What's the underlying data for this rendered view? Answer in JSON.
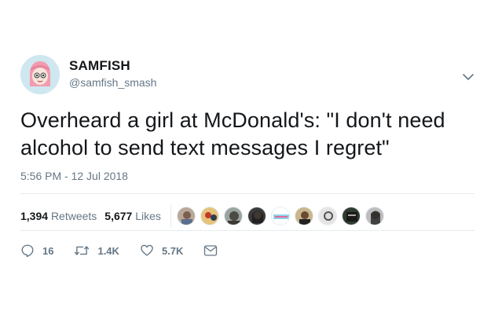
{
  "author": {
    "name": "SAMFISH",
    "handle": "@samfish_smash"
  },
  "tweet": {
    "text": "Overheard a girl at McDonald's: \"I don't need alcohol to send text messages I regret\"",
    "timestamp": "5:56 PM - 12 Jul 2018"
  },
  "stats": {
    "retweets_count": "1,394",
    "retweets_label": "Retweets",
    "likes_count": "5,677",
    "likes_label": "Likes"
  },
  "actions": {
    "reply_count": "16",
    "retweet_count": "1.4K",
    "like_count": "5.7K"
  },
  "colors": {
    "text": "#14171a",
    "secondary": "#657786",
    "divider": "#e6ecf0"
  },
  "icons": [
    "chevron-down-icon",
    "reply-icon",
    "retweet-icon",
    "heart-icon",
    "direct-message-icon"
  ]
}
